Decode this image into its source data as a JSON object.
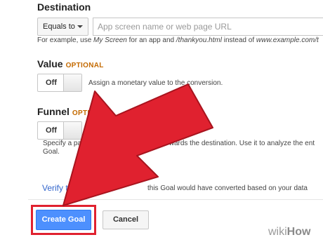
{
  "destination": {
    "heading": "Destination",
    "match_type": "Equals to",
    "url_placeholder": "App screen name or web page URL",
    "example": {
      "prefix": "For example, use ",
      "app_example": "My Screen",
      "middle1": " for an app and ",
      "page_example": "/thankyou.html",
      "middle2": " instead of ",
      "full_example": "www.example.com/t"
    }
  },
  "value": {
    "heading": "Value",
    "optional": "OPTIONAL",
    "toggle": "Off",
    "description": "Assign a monetary value to the conversion."
  },
  "funnel": {
    "heading": "Funnel",
    "optional": "OPTIONAL",
    "toggle": "Off",
    "description_start": "Specify a path yo",
    "description_end": "wards the destination. Use it to analyze the ent",
    "description_line2": "Goal."
  },
  "verify": {
    "link": "Verify thi",
    "rest": "this Goal would have converted based on your data"
  },
  "buttons": {
    "create": "Create Goal",
    "cancel": "Cancel"
  },
  "colors": {
    "primary_button": "#4d90fe",
    "highlight_frame": "#e0212f",
    "arrow": "#e0212f",
    "optional": "#c46a00",
    "link": "#3366cc"
  },
  "watermark": {
    "wiki": "wiki",
    "how": "How"
  }
}
